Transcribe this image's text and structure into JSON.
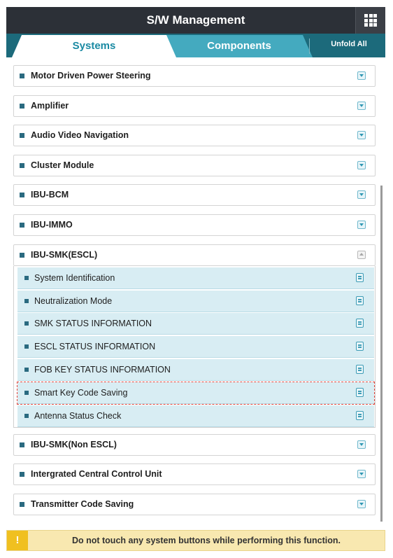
{
  "header": {
    "title": "S/W Management",
    "menu_icon": "grid-icon"
  },
  "tabs": {
    "systems": "Systems",
    "components": "Components",
    "unfold_all": "Unfold All"
  },
  "systems": [
    {
      "label": "Motor Driven Power Steering",
      "icon": "expand-down-icon"
    },
    {
      "label": "Amplifier",
      "icon": "expand-down-icon"
    },
    {
      "label": "Audio Video Navigation",
      "icon": "expand-down-icon"
    },
    {
      "label": "Cluster Module",
      "icon": "expand-down-icon"
    },
    {
      "label": "IBU-BCM",
      "icon": "expand-down-icon"
    },
    {
      "label": "IBU-IMMO",
      "icon": "expand-down-icon"
    },
    {
      "label": "IBU-SMK(ESCL)",
      "icon": "collapse-up-icon"
    },
    {
      "label": "IBU-SMK(Non ESCL)",
      "icon": "expand-down-icon"
    },
    {
      "label": "Intergrated Central Control Unit",
      "icon": "expand-down-icon"
    },
    {
      "label": "Transmitter Code Saving",
      "icon": "expand-down-icon"
    }
  ],
  "expanded_items": [
    {
      "label": "System Identification",
      "icon": "document-icon"
    },
    {
      "label": "Neutralization Mode",
      "icon": "document-icon"
    },
    {
      "label": "SMK STATUS INFORMATION",
      "icon": "document-icon"
    },
    {
      "label": "ESCL STATUS INFORMATION",
      "icon": "document-icon"
    },
    {
      "label": "FOB KEY STATUS INFORMATION",
      "icon": "document-icon"
    },
    {
      "label": "Smart Key Code Saving",
      "icon": "document-icon",
      "highlighted": true
    },
    {
      "label": "Antenna Status Check",
      "icon": "document-icon"
    }
  ],
  "warning": {
    "icon": "!",
    "text": "Do not touch any system buttons while performing this function."
  },
  "colors": {
    "header_bg": "#2c3037",
    "tabbar_bg": "#1c6a7b",
    "active_tab_text": "#1a8aa3",
    "inactive_tab_bg": "#44aabf",
    "subitem_bg": "#d8edf3",
    "highlight_outline": "#e5463c",
    "warning_bg": "#f8e8b0",
    "warning_icon_bg": "#f0c020"
  }
}
